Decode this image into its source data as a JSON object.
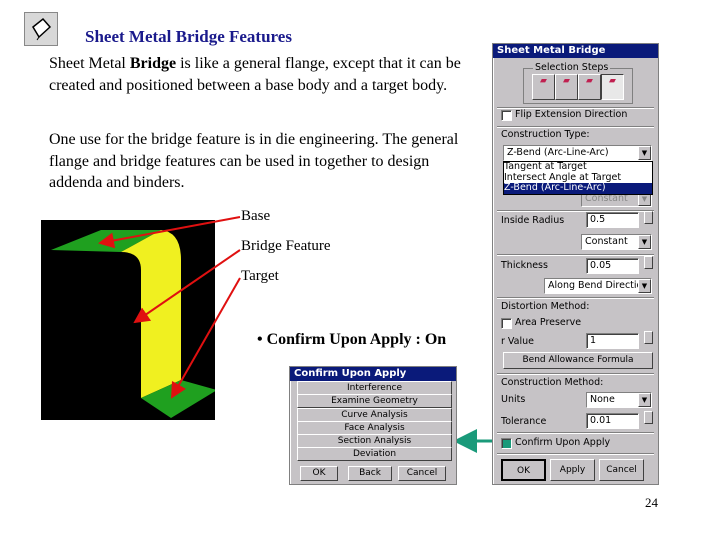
{
  "slide": {
    "title": "Sheet Metal Bridge Features",
    "para1_pre": "Sheet Metal ",
    "para1_bold": "Bridge",
    "para1_post": " is like a general flange, except that it can be created and positioned between a base body and a target body.",
    "para2": "One use for the bridge feature is in die engineering. The general flange and bridge features can be used in together to design addenda and binders.",
    "labels": [
      "Base",
      "Bridge Feature",
      "Target"
    ],
    "bullet": "• Confirm Upon Apply : On",
    "page_number": "24",
    "icon": "sheet-metal-icon"
  },
  "bridge_dialog": {
    "title": "Sheet Metal Bridge",
    "selection_steps_label": "Selection Steps",
    "flip_extension": "Flip Extension Direction",
    "construction_type_label": "Construction Type:",
    "construction_type_value": "Z-Bend (Arc-Line-Arc)",
    "construction_type_options": [
      "Tangent at Target",
      "Intersect Angle at Target",
      "Z-Bend (Arc-Line-Arc)"
    ],
    "hidden_dropdown_value": "Constant",
    "inside_radius_label": "Inside Radius",
    "inside_radius_value": "0.5",
    "radius_mode": "Constant",
    "thickness_label": "Thickness",
    "thickness_value": "0.05",
    "thickness_mode": "Along Bend Direction",
    "distortion_label": "Distortion Method:",
    "area_preserve": "Area Preserve",
    "r_value_label": "r Value",
    "r_value": "1",
    "bend_allowance_button": "Bend Allowance Formula",
    "construction_method_label": "Construction Method:",
    "units_label": "Units",
    "units_value": "None",
    "tolerance_label": "Tolerance",
    "tolerance_value": "0.01",
    "confirm_label": "Confirm Upon Apply",
    "ok": "OK",
    "apply": "Apply",
    "cancel": "Cancel"
  },
  "confirm_dialog": {
    "title": "Confirm Upon Apply",
    "items": [
      "Interference",
      "Examine Geometry",
      "Curve Analysis",
      "Face Analysis",
      "Section Analysis",
      "Deviation"
    ],
    "ok": "OK",
    "back": "Back",
    "cancel": "Cancel"
  },
  "colors": {
    "title": "#1a1a8c",
    "titlebar": "#0a1a7a",
    "arrow_red": "#e01010",
    "arrow_green": "#1a9a7a",
    "flange_green": "#1fa01f",
    "web_yellow": "#f0f020"
  }
}
